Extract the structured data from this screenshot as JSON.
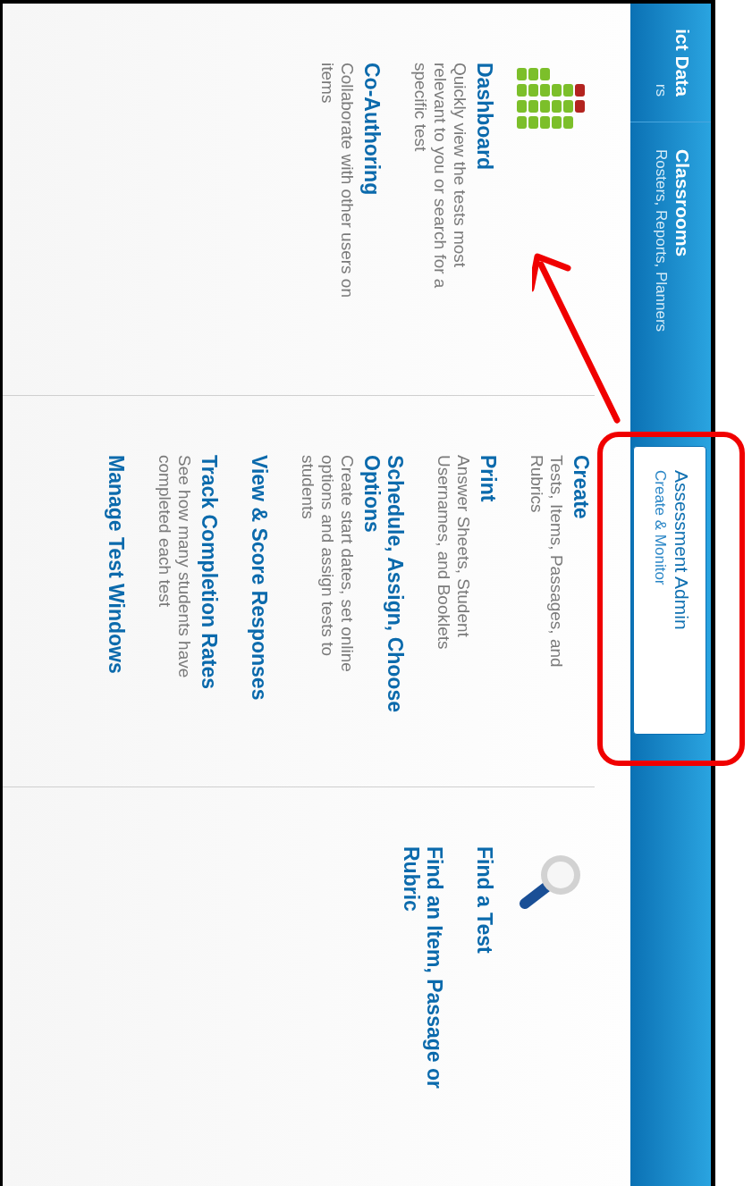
{
  "nav": {
    "items": [
      {
        "title": "ict Data",
        "subtitle": "rs",
        "selected": false
      },
      {
        "title": "Classrooms",
        "subtitle": "Rosters, Reports, Planners",
        "selected": false
      },
      {
        "title": "Assessment Admin",
        "subtitle": "Create & Monitor",
        "selected": true
      }
    ]
  },
  "columns": [
    {
      "entries": [
        {
          "title": "Dashboard",
          "description": "Quickly view the tests most relevant to you or search for a specific test"
        },
        {
          "title": "Co-Authoring",
          "description": "Collaborate with other users on items"
        }
      ]
    },
    {
      "entries": [
        {
          "title": "Create",
          "description": "Tests, Items, Passages, and Rubrics"
        },
        {
          "title": "Print",
          "description": "Answer Sheets, Student Usernames, and Booklets"
        },
        {
          "title": "Schedule, Assign, Choose Options",
          "description": "Create start dates, set online options and assign tests to students"
        },
        {
          "title": "View & Score Responses"
        },
        {
          "title": "Track Completion Rates",
          "description": "See how many students have completed each test"
        },
        {
          "title": "Manage Test Windows"
        }
      ]
    },
    {
      "entries": [
        {
          "title": "Find a Test"
        },
        {
          "title": "Find an Item, Passage or Rubric"
        }
      ]
    }
  ]
}
